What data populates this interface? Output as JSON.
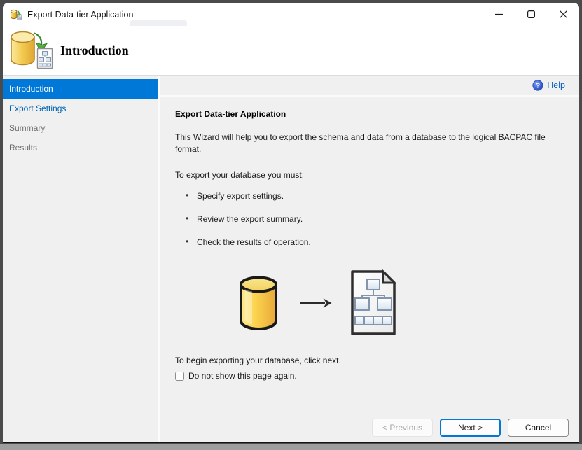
{
  "window": {
    "title": "Export Data-tier Application"
  },
  "header": {
    "title": "Introduction"
  },
  "sidebar": {
    "items": [
      {
        "label": "Introduction",
        "state": "selected"
      },
      {
        "label": "Export Settings",
        "state": "link"
      },
      {
        "label": "Summary",
        "state": "pending"
      },
      {
        "label": "Results",
        "state": "pending"
      }
    ]
  },
  "content": {
    "help_label": "Help",
    "heading": "Export Data-tier Application",
    "intro": "This Wizard will help you to export the schema and data from a database to the logical BACPAC file format.",
    "requirements_label": "To export your database you must:",
    "bullets": [
      "Specify export settings.",
      "Review the export summary.",
      "Check the results of operation."
    ],
    "begin_text": "To begin exporting your database, click next.",
    "checkbox_label": "Do not show this page again.",
    "checkbox_checked": false
  },
  "footer": {
    "previous_label": "< Previous",
    "next_label": "Next >",
    "cancel_label": "Cancel"
  },
  "colors": {
    "selected_item_bg": "#0078d7",
    "sidebar_link_blue": "#0063b1",
    "help_link_blue": "#0a5dc2",
    "next_button_border": "#0078d4",
    "pending_item_text": "#6d6d6d",
    "panel_gray": "#f0f0f0"
  }
}
